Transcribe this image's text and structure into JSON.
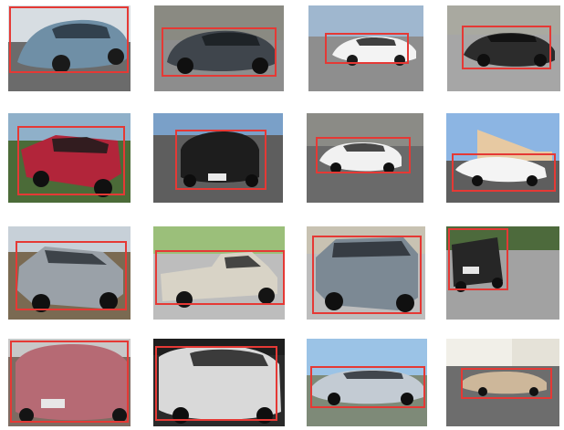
{
  "annotation": {
    "box_color": "#e53935"
  },
  "tiles": [
    {
      "scene": "car-photo",
      "car_color": "#6f8fa6",
      "sky": "#d7dde2",
      "ground": "#6b6b6b",
      "label": ""
    },
    {
      "scene": "car-photo",
      "car_color": "#3f454c",
      "sky": "#8a8a82",
      "ground": "#8d8d8d",
      "label": ""
    },
    {
      "scene": "car-photo",
      "car_color": "#f3f3f3",
      "sky": "#9fb7cf",
      "ground": "#8e8e8e",
      "label": ""
    },
    {
      "scene": "car-photo",
      "car_color": "#2c2c2c",
      "sky": "#a9a9a0",
      "ground": "#a6a6a6",
      "label": ""
    },
    {
      "scene": "car-photo",
      "car_color": "#b2253a",
      "sky": "#8fb0c9",
      "ground": "#4b6b38",
      "label": ""
    },
    {
      "scene": "car-photo",
      "car_color": "#1d1d1d",
      "sky": "#7aa0c8",
      "ground": "#5e5e5e",
      "label": ""
    },
    {
      "scene": "car-photo",
      "car_color": "#f1f1f1",
      "sky": "#8b8b86",
      "ground": "#6a6a6a",
      "label": ""
    },
    {
      "scene": "car-photo",
      "car_color": "#f4f4f4",
      "sky": "#8cb5e3",
      "ground": "#5e5e5e",
      "label": ""
    },
    {
      "scene": "car-photo",
      "car_color": "#9aa1a8",
      "sky": "#c7d0d8",
      "ground": "#7a6a52",
      "label": ""
    },
    {
      "scene": "car-photo",
      "car_color": "#d8d3c6",
      "sky": "#9bbf7a",
      "ground": "#bdbdbd",
      "label": ""
    },
    {
      "scene": "car-photo",
      "car_color": "#7c8994",
      "sky": "#c8c2b2",
      "ground": "#bdbdbd",
      "label": ""
    },
    {
      "scene": "car-photo",
      "car_color": "#262626",
      "sky": "#4d6a3c",
      "ground": "#a2a2a2",
      "label": ""
    },
    {
      "scene": "car-photo",
      "car_color": "#b66a74",
      "sky": "#c8c8c8",
      "ground": "#7e6b62",
      "label": ""
    },
    {
      "scene": "car-photo",
      "car_color": "#d9d9d9",
      "sky": "#1e1e1e",
      "ground": "#2a2a2a",
      "label": ""
    },
    {
      "scene": "car-photo",
      "car_color": "#c3cbd3",
      "sky": "#9bc3e6",
      "ground": "#7e8a78",
      "label": ""
    },
    {
      "scene": "car-photo",
      "car_color": "#cdb79a",
      "sky": "#f1efe8",
      "ground": "#6d6d6d",
      "label": ""
    }
  ]
}
